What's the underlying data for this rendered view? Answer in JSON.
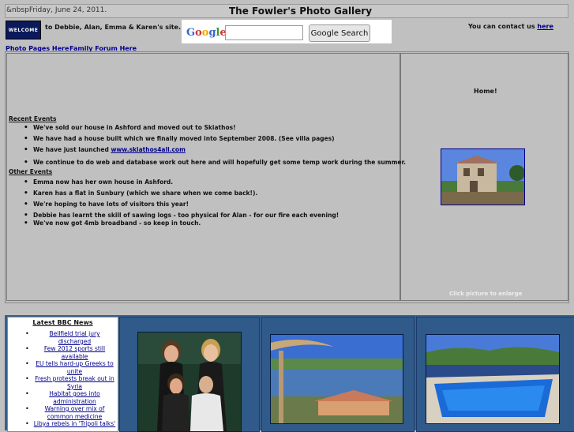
{
  "header": {
    "date": "&nbspFriday, June 24, 2011.",
    "title": "The Fowler's Photo Gallery",
    "welcome_badge": "WELCOME",
    "greeting": "to Debbie, Alan, Emma & Karen's site. Hope you enjoy these pictures, we'll try to keep them up to date!",
    "contact_prefix": "You can contact us ",
    "contact_link": "here"
  },
  "search": {
    "logo": "Google",
    "button_label": "Google Search",
    "input_value": ""
  },
  "nav": {
    "photo_pages": "Photo Pages Here",
    "family_forum": "Family Forum Here"
  },
  "main": {
    "recent_heading": "Recent Events",
    "recent_events": [
      {
        "text": "We've sold our house in Ashford and moved out to Skiathos!"
      },
      {
        "text": "We have had a house built which we finally moved into September 2008. (See villa pages)"
      },
      {
        "text": "We have just launched ",
        "link": "www.skiathos4all.com"
      },
      {
        "text": "We continue to do web and database work out here and will hopefully get some temp work during the summer."
      }
    ],
    "other_heading": "Other Events",
    "other_events": [
      "Emma now has her own house in Ashford.",
      "Karen has a flat in Sunbury (which we share when we come back!).",
      "We're hoping to have lots of visitors this year!",
      "Debbie has learnt the skill of sawing logs - too physical for Alan - for our fire each evening!",
      "We've now got 4mb broadband - so keep in touch."
    ]
  },
  "side": {
    "home_label": "Home!",
    "enlarge_caption": "Click picture to enlarge"
  },
  "news": {
    "title": "Latest BBC News",
    "items": [
      "Bellfield trial jury discharged",
      "Few 2012 sports still available",
      "EU tells hard-up Greeks to unite",
      "Fresh protests break out in Syria",
      "Habitat goes into administration",
      "Warning over mix of common medicine",
      "Libya rebels in 'Tripoli talks'"
    ]
  }
}
